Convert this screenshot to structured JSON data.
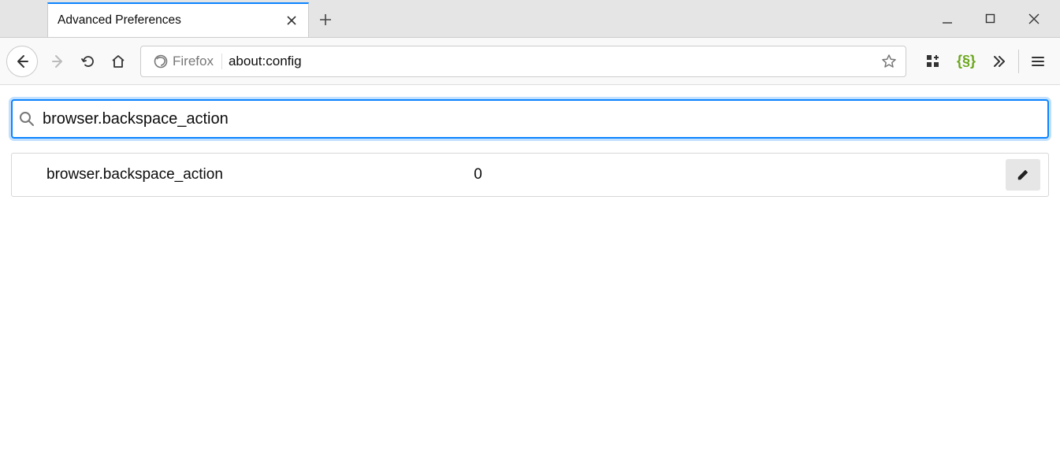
{
  "tab": {
    "title": "Advanced Preferences"
  },
  "urlbar": {
    "identity_label": "Firefox",
    "url": "about:config"
  },
  "config": {
    "search_value": "browser.backspace_action",
    "result": {
      "name": "browser.backspace_action",
      "value": "0"
    }
  }
}
